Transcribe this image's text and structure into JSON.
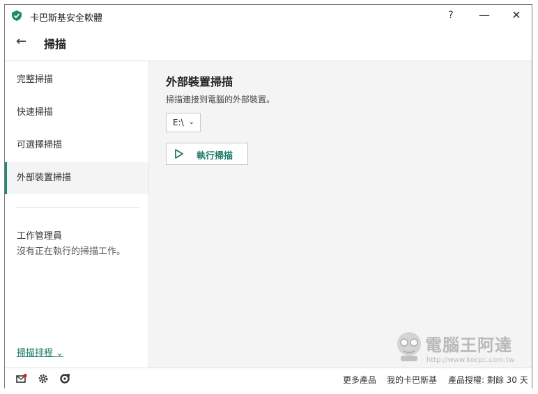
{
  "window": {
    "title": "卡巴斯基安全軟體",
    "help": "?",
    "minimize": "—",
    "close": "✕"
  },
  "header": {
    "back": "←",
    "title": "掃描"
  },
  "sidebar": {
    "items": [
      {
        "label": "完整掃描"
      },
      {
        "label": "快速掃描"
      },
      {
        "label": "可選擇掃描"
      },
      {
        "label": "外部裝置掃描"
      }
    ],
    "task_manager_title": "工作管理員",
    "task_manager_status": "沒有正在執行的掃描工作。",
    "schedule_link": "掃描排程 ⌄"
  },
  "main": {
    "title": "外部裝置掃描",
    "description": "掃描連接到電腦的外部裝置。",
    "drive_value": "E:\\",
    "run_button": "執行掃描"
  },
  "footer": {
    "more_products": "更多產品",
    "my_kaspersky": "我的卡巴斯基",
    "license": "產品授權: 剩餘 30 天"
  },
  "watermark": {
    "text": "電腦王阿達",
    "url": "http://www.kocpc.com.tw"
  },
  "colors": {
    "accent": "#1a8a73",
    "link": "#1a7a66",
    "main_bg": "#f4f4f4"
  },
  "icons": {
    "app": "kaspersky-shield-icon",
    "play": "play-icon",
    "mail": "mail-notification-icon",
    "settings": "gear-icon",
    "support": "support-icon"
  }
}
